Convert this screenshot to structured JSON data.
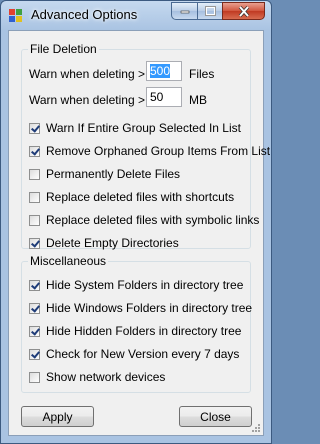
{
  "window": {
    "title": "Advanced Options"
  },
  "file_deletion": {
    "legend": "File Deletion",
    "warn_files_label": "Warn when deleting >",
    "warn_files_value": "500",
    "warn_files_unit": "Files",
    "warn_mb_label": "Warn when deleting >",
    "warn_mb_value": "50",
    "warn_mb_unit": "MB",
    "options": [
      {
        "label": "Warn If Entire Group Selected In List",
        "checked": true
      },
      {
        "label": "Remove Orphaned Group Items From List",
        "checked": true
      },
      {
        "label": "Permanently Delete Files",
        "checked": false
      },
      {
        "label": "Replace deleted files with shortcuts",
        "checked": false
      },
      {
        "label": "Replace deleted files with symbolic links",
        "checked": false
      },
      {
        "label": "Delete Empty Directories",
        "checked": true
      }
    ]
  },
  "misc": {
    "legend": "Miscellaneous",
    "options": [
      {
        "label": "Hide System Folders in directory tree",
        "checked": true
      },
      {
        "label": "Hide Windows Folders in directory tree",
        "checked": true
      },
      {
        "label": "Hide Hidden Folders in directory tree",
        "checked": true
      },
      {
        "label": "Check for New Version every 7 days",
        "checked": true
      },
      {
        "label": "Show network devices",
        "checked": false
      }
    ]
  },
  "buttons": {
    "apply": "Apply",
    "close": "Close"
  },
  "icons": {
    "app": "app-icon",
    "minimize": "minimize-icon",
    "maximize": "maximize-icon",
    "close": "close-icon"
  }
}
